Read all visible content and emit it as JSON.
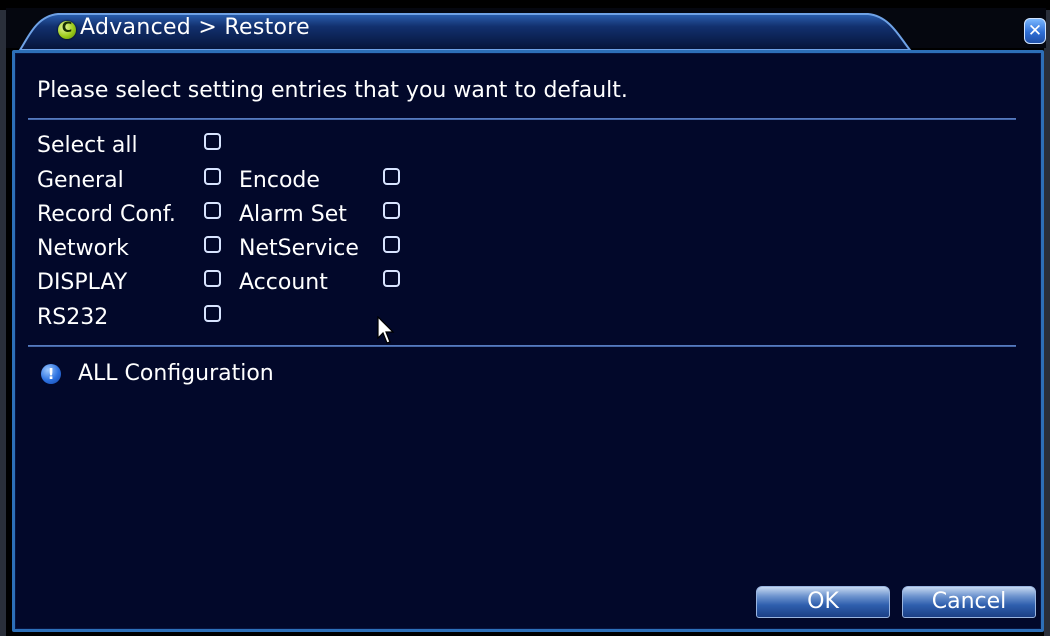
{
  "titlebar": {
    "logo_letter": "C",
    "title": "Advanced > Restore",
    "close_glyph": "✕"
  },
  "instruction": "Please select setting entries that you want to default.",
  "options": {
    "select_all": {
      "label": "Select all",
      "checked": false
    },
    "general": {
      "label": "General",
      "checked": false
    },
    "encode": {
      "label": "Encode",
      "checked": false
    },
    "record_conf": {
      "label": "Record Conf.",
      "checked": false
    },
    "alarm_set": {
      "label": "Alarm Set",
      "checked": false
    },
    "network": {
      "label": "Network",
      "checked": false
    },
    "netservice": {
      "label": "NetService",
      "checked": false
    },
    "display": {
      "label": "DISPLAY",
      "checked": false
    },
    "account": {
      "label": "Account",
      "checked": false
    },
    "rs232": {
      "label": "RS232",
      "checked": false
    }
  },
  "info": {
    "icon": "info-icon",
    "glyph": "!",
    "text": "ALL Configuration"
  },
  "buttons": {
    "ok": "OK",
    "cancel": "Cancel"
  },
  "colors": {
    "panel_background": "#02082a",
    "panel_border": "#2d6fb8",
    "text": "#ffffff",
    "logo": "#9ccc1a"
  }
}
